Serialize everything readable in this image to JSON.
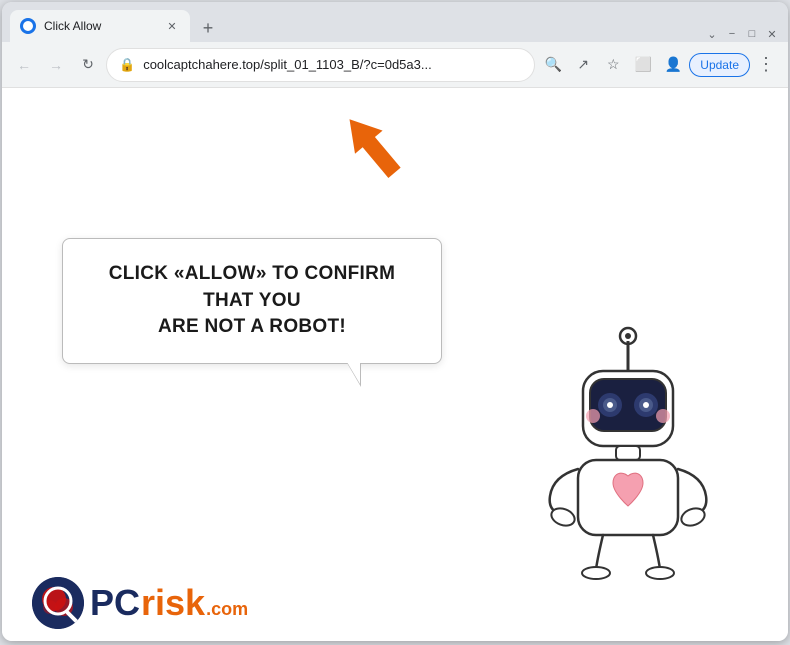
{
  "browser": {
    "tab": {
      "title": "Click Allow",
      "favicon_label": "site-favicon"
    },
    "new_tab_label": "+",
    "window_controls": {
      "chevron_down": "⌄",
      "minimize": "−",
      "maximize": "□",
      "close": "✕"
    },
    "nav": {
      "back_label": "←",
      "forward_label": "→",
      "refresh_label": "↻",
      "url": "coolcaptchahere.top/split_01_1103_B/?c=0d5a3...",
      "search_label": "🔍",
      "share_label": "↗",
      "bookmark_label": "☆",
      "extensions_label": "⬜",
      "profile_label": "👤",
      "update_label": "Update",
      "menu_label": "⋮"
    }
  },
  "page": {
    "arrow_label": "orange-arrow-pointing-up",
    "bubble_text_line1": "CLICK «ALLOW» TO CONFIRM THAT YOU",
    "bubble_text_line2": "ARE NOT A ROBOT!",
    "robot_label": "robot-illustration",
    "watermark": {
      "pc_text": "PC",
      "risk_text": "risk",
      "dot_com": ".com"
    }
  }
}
